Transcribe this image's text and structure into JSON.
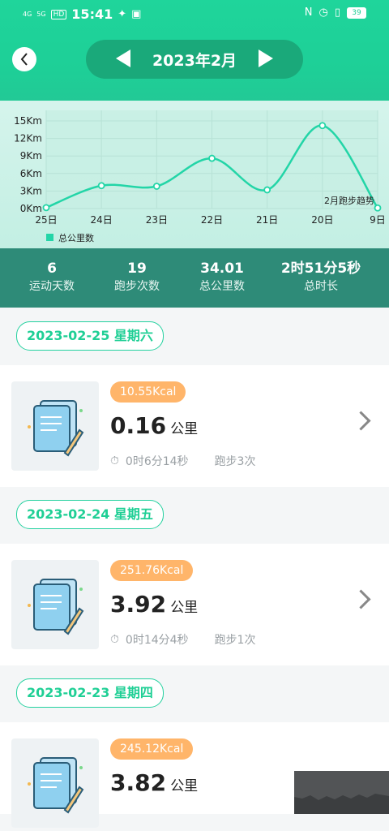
{
  "status_bar": {
    "signal_left": "4G",
    "signal_right": "5G",
    "hd": "HD",
    "time": "15:41",
    "battery": "39"
  },
  "header": {
    "month": "2023年2月"
  },
  "chart_data": {
    "type": "line",
    "x": [
      "25日",
      "24日",
      "23日",
      "22日",
      "21日",
      "20日",
      "9日"
    ],
    "series": [
      {
        "name": "总公里数",
        "values": [
          0.16,
          3.92,
          3.82,
          8.6,
          3.2,
          14.2,
          0.1
        ]
      }
    ],
    "y_ticks": [
      "15Km",
      "12Km",
      "9Km",
      "6Km",
      "3Km",
      "0Km"
    ],
    "ylim": [
      0,
      15
    ],
    "annotation": "2月跑步趋势",
    "legend": "bottom-left",
    "color": "#23d5a7"
  },
  "stats": [
    {
      "value": "6",
      "label": "运动天数"
    },
    {
      "value": "19",
      "label": "跑步次数"
    },
    {
      "value": "34.01",
      "label": "总公里数"
    },
    {
      "value": "2时51分5秒",
      "label": "总时长"
    }
  ],
  "days": [
    {
      "date": "2023-02-25 星期六",
      "kcal": "10.55Kcal",
      "distance": "0.16",
      "unit": "公里",
      "duration": "0时6分14秒",
      "runs": "跑步3次"
    },
    {
      "date": "2023-02-24 星期五",
      "kcal": "251.76Kcal",
      "distance": "3.92",
      "unit": "公里",
      "duration": "0时14分4秒",
      "runs": "跑步1次"
    },
    {
      "date": "2023-02-23 星期四",
      "kcal": "245.12Kcal",
      "distance": "3.82",
      "unit": "公里",
      "duration": "",
      "runs": ""
    }
  ]
}
